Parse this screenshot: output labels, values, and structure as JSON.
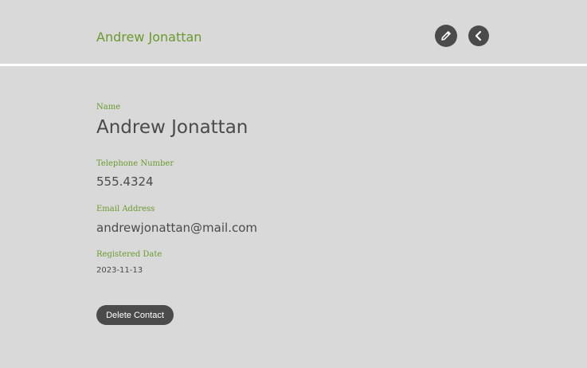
{
  "header": {
    "title": "Andrew Jonattan",
    "edit_icon": "pencil-icon",
    "back_icon": "chevron-left-icon"
  },
  "contact": {
    "name_label": "Name",
    "name": "Andrew Jonattan",
    "phone_label": "Telephone Number",
    "phone": "555.4324",
    "email_label": "Email Address",
    "email": "andrewjonattan@mail.com",
    "date_label": "Registered Date",
    "date": "2023-11-13"
  },
  "actions": {
    "delete_label": "Delete Contact"
  },
  "colors": {
    "accent": "#6a9a2e",
    "background": "#d9d9d9",
    "button": "#4b4b4b",
    "text": "#4a4a4a"
  }
}
